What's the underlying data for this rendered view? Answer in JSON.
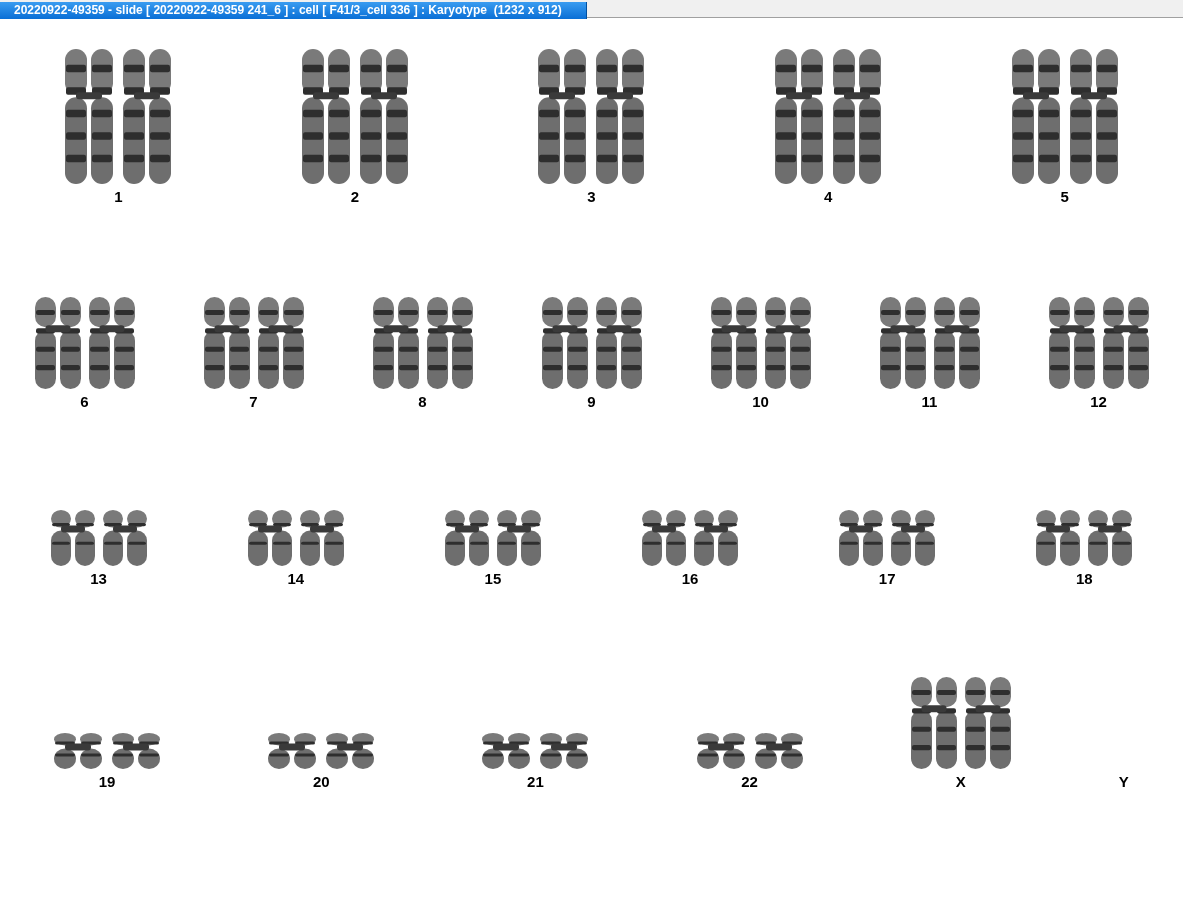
{
  "window": {
    "title": "20220922-49359 - slide [ 20220922-49359 241_6 ] : cell [ F41/3_cell 336 ] : Karyotype  (1232 x 912)"
  },
  "karyotype": {
    "rows": [
      {
        "pairs": [
          {
            "label": "1",
            "kind": "large"
          },
          {
            "label": "2",
            "kind": "large"
          },
          {
            "label": "3",
            "kind": "large"
          },
          {
            "label": "4",
            "kind": "large"
          },
          {
            "label": "5",
            "kind": "large"
          }
        ]
      },
      {
        "pairs": [
          {
            "label": "6",
            "kind": "medium"
          },
          {
            "label": "7",
            "kind": "medium"
          },
          {
            "label": "8",
            "kind": "medium"
          },
          {
            "label": "9",
            "kind": "medium"
          },
          {
            "label": "10",
            "kind": "medium"
          },
          {
            "label": "11",
            "kind": "medium"
          },
          {
            "label": "12",
            "kind": "medium"
          }
        ]
      },
      {
        "pairs": [
          {
            "label": "13",
            "kind": "small"
          },
          {
            "label": "14",
            "kind": "small"
          },
          {
            "label": "15",
            "kind": "small"
          },
          {
            "label": "16",
            "kind": "small"
          },
          {
            "label": "17",
            "kind": "small"
          },
          {
            "label": "18",
            "kind": "small"
          }
        ]
      },
      {
        "pairs": [
          {
            "label": "19",
            "kind": "tiny"
          },
          {
            "label": "20",
            "kind": "tiny"
          },
          {
            "label": "21",
            "kind": "tiny"
          },
          {
            "label": "22",
            "kind": "tiny"
          },
          {
            "label": "X",
            "kind": "medium"
          },
          {
            "label": "Y",
            "kind": "empty"
          }
        ]
      }
    ]
  }
}
